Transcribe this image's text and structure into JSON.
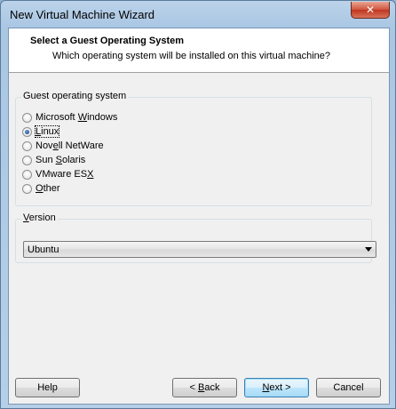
{
  "window": {
    "title": "New Virtual Machine Wizard",
    "close_label": "✕"
  },
  "header": {
    "title": "Select a Guest Operating System",
    "subtitle": "Which operating system will be installed on this virtual machine?"
  },
  "guest_os": {
    "legend": "Guest operating system",
    "options": [
      {
        "pre": "Microsoft ",
        "key": "W",
        "post": "indows",
        "checked": false
      },
      {
        "pre": "",
        "key": "L",
        "post": "inux",
        "checked": true
      },
      {
        "pre": "Nov",
        "key": "e",
        "post": "ll NetWare",
        "checked": false
      },
      {
        "pre": "Sun ",
        "key": "S",
        "post": "olaris",
        "checked": false
      },
      {
        "pre": "VMware ES",
        "key": "X",
        "post": "",
        "checked": false
      },
      {
        "pre": "",
        "key": "O",
        "post": "ther",
        "checked": false
      }
    ]
  },
  "version": {
    "legend_pre": "",
    "legend_key": "V",
    "legend_post": "ersion",
    "selected": "Ubuntu"
  },
  "buttons": {
    "help": "Help",
    "back_pre": "< ",
    "back_key": "B",
    "back_post": "ack",
    "next_pre": "",
    "next_key": "N",
    "next_post": "ext >",
    "cancel": "Cancel"
  }
}
